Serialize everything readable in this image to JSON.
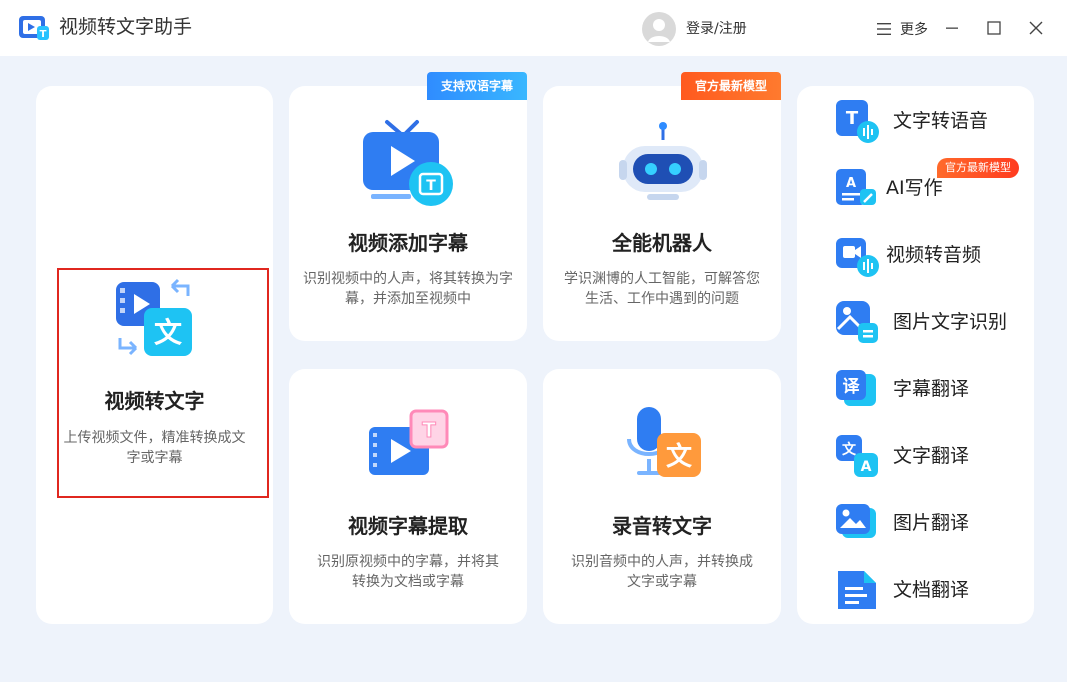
{
  "app": {
    "title": "视频转文字助手"
  },
  "header": {
    "login_label": "登录/注册",
    "more_label": "更多"
  },
  "main_card": {
    "title": "视频转文字",
    "desc_line1": "上传视频文件，精准转换成文",
    "desc_line2": "字或字幕"
  },
  "cards": [
    {
      "title": "视频添加字幕",
      "desc_line1": "识别视频中的人声，将其转换为字",
      "desc_line2": "幕，并添加至视频中",
      "badge": "支持双语字幕"
    },
    {
      "title": "全能机器人",
      "desc_line1": "学识渊博的人工智能，可解答您",
      "desc_line2": "生活、工作中遇到的问题",
      "badge": "官方最新模型"
    },
    {
      "title": "视频字幕提取",
      "desc_line1": "识别原视频中的字幕，并将其",
      "desc_line2": "转换为文档或字幕"
    },
    {
      "title": "录音转文字",
      "desc_line1": "识别音频中的人声，并转换成",
      "desc_line2": "文字或字幕"
    }
  ],
  "side": {
    "items": [
      {
        "label": "文字转语音"
      },
      {
        "label": "AI写作",
        "badge": "官方最新模型"
      },
      {
        "label": "视频转音频"
      },
      {
        "label": "图片文字识别"
      },
      {
        "label": "字幕翻译"
      },
      {
        "label": "文字翻译"
      },
      {
        "label": "图片翻译"
      },
      {
        "label": "文档翻译"
      }
    ]
  },
  "icons": {
    "app_logo": "app-logo-icon",
    "avatar": "user-avatar-icon",
    "menu": "hamburger-menu-icon",
    "minimize": "minimize-icon",
    "maximize": "maximize-icon",
    "close": "close-icon"
  },
  "colors": {
    "background": "#eef3fb",
    "brand_blue": "#2f8cff",
    "accent_orange": "#ff5a1f",
    "selection_red": "#e0271f"
  }
}
